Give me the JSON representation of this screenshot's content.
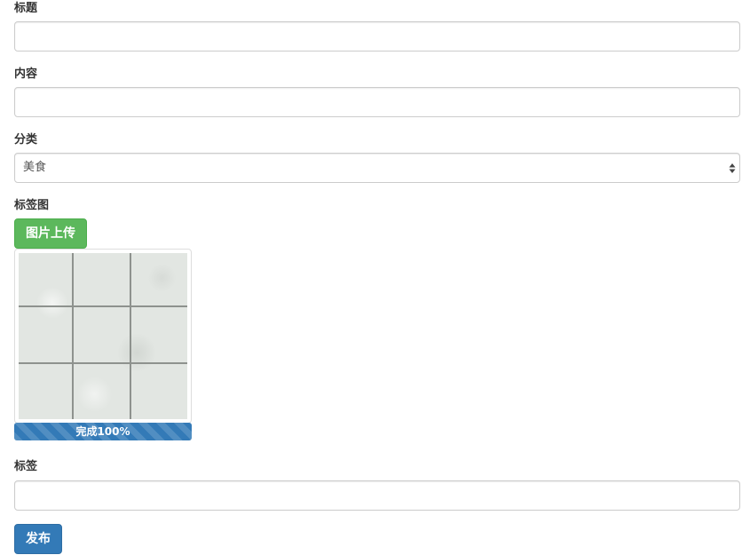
{
  "form": {
    "title_label": "标题",
    "title_value": "",
    "content_label": "内容",
    "content_value": "",
    "category_label": "分类",
    "category_selected": "美食",
    "tag_image_label": "标签图",
    "upload_button": "图片上传",
    "upload_progress_text": "完成100%",
    "upload_progress_percent": 100,
    "tags_label": "标签",
    "tags_value": "",
    "submit_button": "发布"
  },
  "colors": {
    "success": "#5cb85c",
    "primary": "#337ab7",
    "border": "#cccccc",
    "text": "#333333"
  },
  "icons": {
    "select_arrows": "up-down-arrows-icon"
  }
}
